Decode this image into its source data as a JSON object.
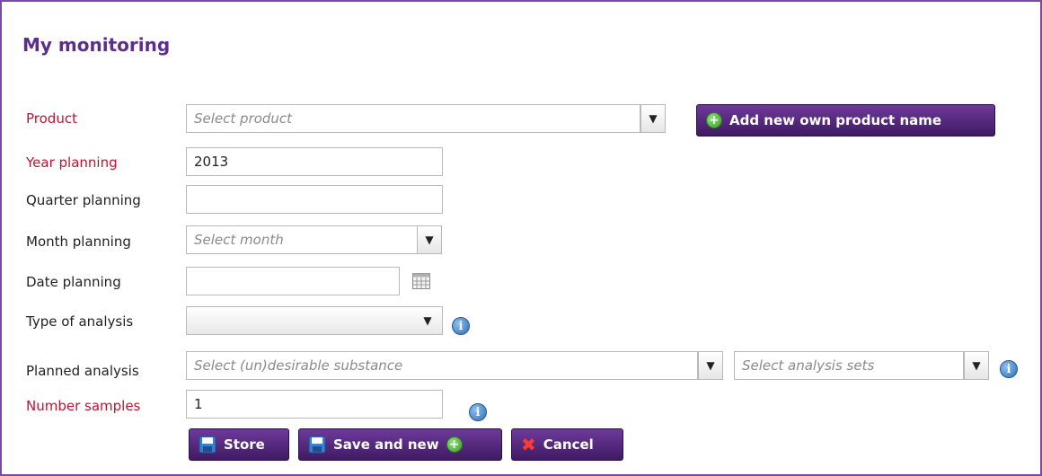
{
  "page": {
    "title": "My monitoring"
  },
  "form": {
    "product": {
      "label": "Product",
      "placeholder": "Select product"
    },
    "add_product_button": "Add new own product name",
    "year": {
      "label": "Year planning",
      "value": "2013"
    },
    "quarter": {
      "label": "Quarter planning",
      "value": ""
    },
    "month": {
      "label": "Month planning",
      "placeholder": "Select month"
    },
    "date": {
      "label": "Date planning",
      "value": ""
    },
    "type_analysis": {
      "label": "Type of analysis",
      "value": ""
    },
    "planned_analysis": {
      "label": "Planned analysis",
      "substance_placeholder": "Select (un)desirable substance",
      "sets_placeholder": "Select analysis sets"
    },
    "samples": {
      "label": "Number samples",
      "value": "1"
    }
  },
  "buttons": {
    "store": "Store",
    "save_and_new": "Save and new",
    "cancel": "Cancel"
  },
  "icons": {
    "dropdown": "chevron-down-icon",
    "calendar": "calendar-icon",
    "info": "info-icon",
    "plus": "plus-circle-icon",
    "save": "floppy-disk-icon",
    "cancel": "x-icon"
  },
  "colors": {
    "accent": "#5b2e8c",
    "button": "#4a2270",
    "required": "#c8102e",
    "border": "#7a4aa6"
  }
}
